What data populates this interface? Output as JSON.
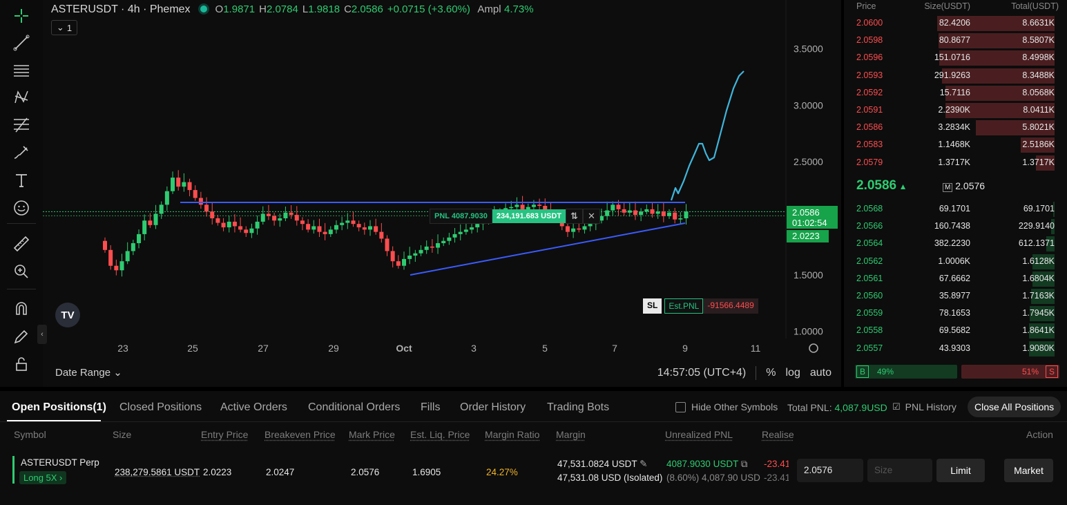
{
  "legend": {
    "symbol": "ASTERUSDT · 4h · Phemex",
    "o_label": "O",
    "o_value": "1.9871",
    "h_label": "H",
    "h_value": "2.0784",
    "l_label": "L",
    "l_value": "1.9818",
    "c_label": "C",
    "c_value": "2.0586",
    "change": "+0.0715 (+3.60%)",
    "ampl_label": "Ampl",
    "ampl_value": "4.73%",
    "indicator_count": "1"
  },
  "chart": {
    "y_ticks": [
      "3.5000",
      "3.0000",
      "2.5000",
      "1.5000",
      "1.0000"
    ],
    "x_ticks": [
      "23",
      "25",
      "27",
      "29",
      "Oct",
      "3",
      "5",
      "7",
      "9",
      "11"
    ],
    "last_price": "2.0586",
    "countdown": "01:02:54",
    "entry_price_tag": "2.0223",
    "pnl_label": "PNL 4087.9030",
    "position_size": "234,191.683 USDT",
    "sl_label": "SL",
    "est_pnl_label": "Est.PNL",
    "est_pnl_value": "-91566.4489",
    "date_range": "Date Range",
    "time": "14:57:05 (UTC+4)",
    "pct": "%",
    "log": "log",
    "auto": "auto",
    "colors": {
      "up": "#2ecc71",
      "down": "#ff4d4f",
      "trendline": "#3b5bff",
      "projection": "#3fb6dc"
    }
  },
  "orderbook": {
    "headers": {
      "price": "Price",
      "size": "Size(USDT)",
      "total": "Total(USDT)"
    },
    "asks": [
      {
        "price": "2.0600",
        "size": "82.4206",
        "total": "8.6631K",
        "depth": 1.0
      },
      {
        "price": "2.0598",
        "size": "80.8677",
        "total": "8.5807K",
        "depth": 0.99
      },
      {
        "price": "2.0596",
        "size": "151.0716",
        "total": "8.4998K",
        "depth": 0.98
      },
      {
        "price": "2.0593",
        "size": "291.9263",
        "total": "8.3488K",
        "depth": 0.96
      },
      {
        "price": "2.0592",
        "size": "15.7116",
        "total": "8.0568K",
        "depth": 0.93
      },
      {
        "price": "2.0591",
        "size": "2.2390K",
        "total": "8.0411K",
        "depth": 0.93
      },
      {
        "price": "2.0586",
        "size": "3.2834K",
        "total": "5.8021K",
        "depth": 0.67
      },
      {
        "price": "2.0583",
        "size": "1.1468K",
        "total": "2.5186K",
        "depth": 0.29
      },
      {
        "price": "2.0579",
        "size": "1.3717K",
        "total": "1.3717K",
        "depth": 0.16
      }
    ],
    "last_price": "2.0586",
    "mark_label": "M",
    "mark_price": "2.0576",
    "bids": [
      {
        "price": "2.0568",
        "size": "69.1701",
        "total": "69.1701",
        "depth": 0.01
      },
      {
        "price": "2.0566",
        "size": "160.7438",
        "total": "229.9140",
        "depth": 0.03
      },
      {
        "price": "2.0564",
        "size": "382.2230",
        "total": "612.1371",
        "depth": 0.07
      },
      {
        "price": "2.0562",
        "size": "1.0006K",
        "total": "1.6128K",
        "depth": 0.19
      },
      {
        "price": "2.0561",
        "size": "67.6662",
        "total": "1.6804K",
        "depth": 0.19
      },
      {
        "price": "2.0560",
        "size": "35.8977",
        "total": "1.7163K",
        "depth": 0.2
      },
      {
        "price": "2.0559",
        "size": "78.1653",
        "total": "1.7945K",
        "depth": 0.21
      },
      {
        "price": "2.0558",
        "size": "69.5682",
        "total": "1.8641K",
        "depth": 0.22
      },
      {
        "price": "2.0557",
        "size": "43.9303",
        "total": "1.9080K",
        "depth": 0.22
      }
    ],
    "buy_label": "B",
    "buy_pct": "49%",
    "sell_label": "S",
    "sell_pct": "51%"
  },
  "panel": {
    "tabs": [
      "Open Positions(1)",
      "Closed Positions",
      "Active Orders",
      "Conditional Orders",
      "Fills",
      "Order History",
      "Trading Bots"
    ],
    "hide_other": "Hide Other Symbols",
    "total_pnl_label": "Total PNL: ",
    "total_pnl_value": "4,087.9USD",
    "pnl_history": "PNL History",
    "close_all": "Close All Positions",
    "columns": [
      "Symbol",
      "Size",
      "Entry Price",
      "Breakeven Price",
      "Mark Price",
      "Est. Liq. Price",
      "Margin Ratio",
      "Margin",
      "Unrealized PNL",
      "Realise",
      "Action"
    ],
    "position": {
      "symbol": "ASTERUSDT Perp",
      "side": "Long 5X",
      "size": "238,279.5861 USDT",
      "entry": "2.0223",
      "breakeven": "2.0247",
      "mark": "2.0576",
      "liq": "1.6905",
      "margin_ratio": "24.27%",
      "margin1": "47,531.0824 USDT",
      "margin2": "47,531.08 USD (Isolated)",
      "upnl1": "4087.9030 USDT",
      "upnl2": "(8.60%) 4,087.90 USD",
      "realised1": "-23.41",
      "realised2": "-23.41",
      "price_input": "2.0576",
      "size_placeholder": "Size",
      "limit": "Limit",
      "market": "Market"
    }
  }
}
